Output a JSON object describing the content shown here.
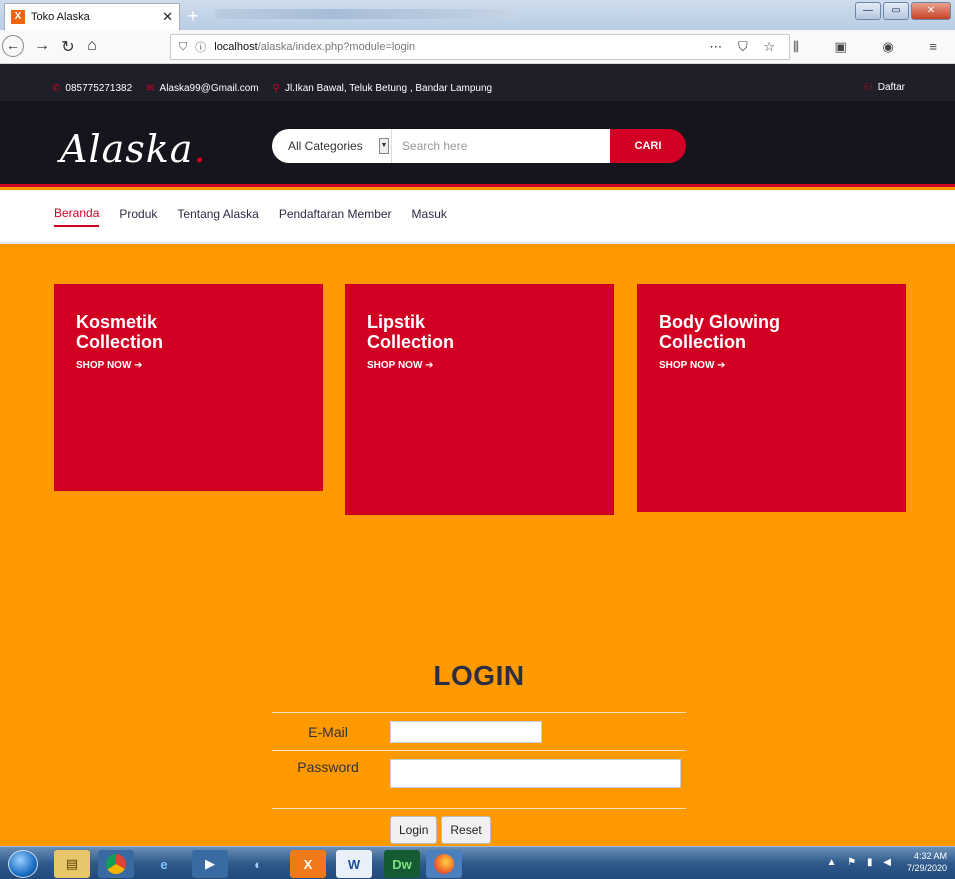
{
  "browser": {
    "tab_title": "Toko Alaska",
    "url_host": "localhost",
    "url_path": "/alaska/index.php?module=login"
  },
  "topbar": {
    "phone": "085775271382",
    "email": "Alaska99@Gmail.com",
    "address": "Jl.Ikan Bawal, Teluk Betung , Bandar Lampung",
    "register": "Daftar"
  },
  "header": {
    "logo": "Alaska",
    "category": "All Categories",
    "search_placeholder": "Search here",
    "search_button": "CARI"
  },
  "nav": {
    "items": [
      "Beranda",
      "Produk",
      "Tentang Alaska",
      "Pendaftaran Member",
      "Masuk"
    ]
  },
  "collections": [
    {
      "line1": "Kosmetik",
      "line2": "Collection",
      "cta": "SHOP NOW"
    },
    {
      "line1": "Lipstik",
      "line2": "Collection",
      "cta": "SHOP NOW"
    },
    {
      "line1": "Body Glowing",
      "line2": "Collection",
      "cta": "SHOP NOW"
    }
  ],
  "login": {
    "title": "LOGIN",
    "email_label": "E-Mail",
    "password_label": "Password",
    "login_button": "Login",
    "reset_button": "Reset"
  },
  "taskbar": {
    "time": "4:32 AM",
    "date": "7/29/2020"
  },
  "colors": {
    "accent": "#d10024",
    "page_bg": "#ff9900",
    "header_bg": "#15161d"
  }
}
